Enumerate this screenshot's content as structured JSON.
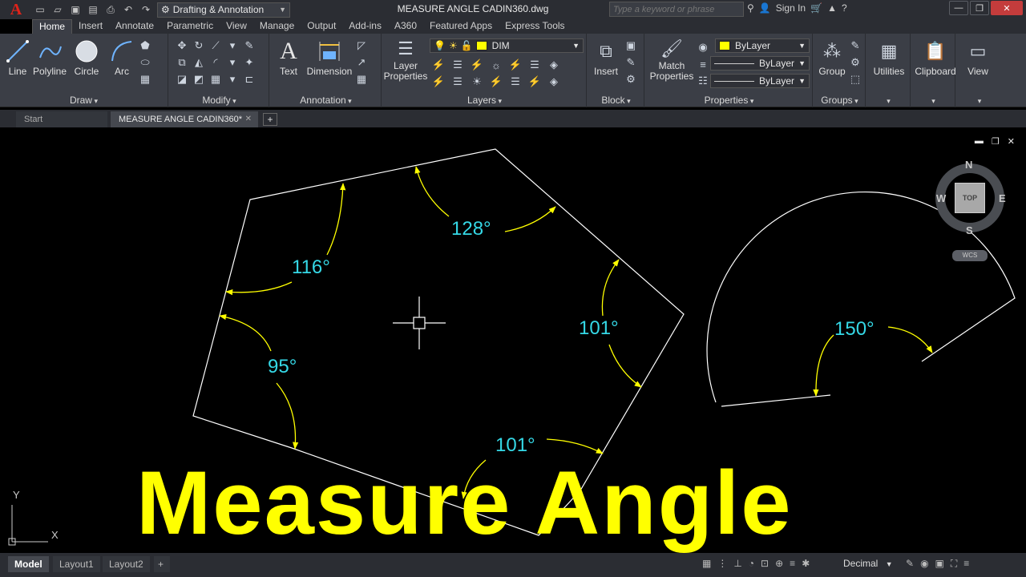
{
  "titlebar": {
    "app_logo": "A",
    "workspace": "Drafting & Annotation",
    "window_title": "MEASURE ANGLE  CADIN360.dwg",
    "search_placeholder": "Type a keyword or phrase",
    "sign_in": "Sign In",
    "help": "?"
  },
  "ribbon_tabs": [
    "Home",
    "Insert",
    "Annotate",
    "Parametric",
    "View",
    "Manage",
    "Output",
    "Add-ins",
    "A360",
    "Featured Apps",
    "Express Tools"
  ],
  "panels": {
    "draw": {
      "title": "Draw",
      "buttons": [
        "Line",
        "Polyline",
        "Circle",
        "Arc"
      ]
    },
    "modify": {
      "title": "Modify"
    },
    "annotation": {
      "title": "Annotation",
      "buttons": [
        "Text",
        "Dimension"
      ]
    },
    "layers": {
      "title": "Layers",
      "layer_properties": "Layer Properties",
      "current_layer": "DIM"
    },
    "block": {
      "title": "Block",
      "insert": "Insert"
    },
    "properties": {
      "title": "Properties",
      "match": "Match Properties",
      "color": "ByLayer",
      "linetype": "ByLayer",
      "lineweight": "ByLayer"
    },
    "groups": {
      "title": "Groups",
      "group": "Group"
    },
    "utilities": {
      "title": "Utilities"
    },
    "clipboard": {
      "title": "Clipboard"
    },
    "view": {
      "title": "View"
    }
  },
  "doc_tabs": {
    "start": "Start",
    "active": "MEASURE ANGLE  CADIN360*",
    "add": "+"
  },
  "viewcube": {
    "n": "N",
    "s": "S",
    "e": "E",
    "w": "W",
    "top": "TOP",
    "wcs": "WCS"
  },
  "drawing": {
    "angles": [
      "128°",
      "116°",
      "101°",
      "95°",
      "101°",
      "150°"
    ],
    "ucs_y": "Y",
    "ucs_x": "X"
  },
  "overlay_title": "Measure Angle",
  "status": {
    "model": "Model",
    "layout1": "Layout1",
    "layout2": "Layout2",
    "add": "+",
    "units": "Decimal"
  },
  "colors": {
    "dim_text": "#35d8e6",
    "arrow": "#ffff00",
    "line": "#ffffff",
    "overlay": "#ffff00"
  }
}
